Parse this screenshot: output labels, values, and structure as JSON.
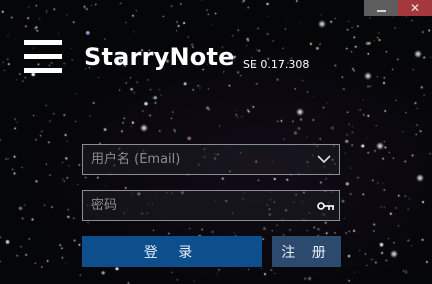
{
  "window": {
    "minimize_icon": "minimize-icon",
    "close_icon": "close-icon"
  },
  "header": {
    "menu_icon": "hamburger-menu-icon",
    "app_name": "StarryNote",
    "version": "SE 0.17.308"
  },
  "login": {
    "username": {
      "value": "",
      "placeholder": "用户名 (Email)",
      "dropdown_icon": "chevron-down-icon"
    },
    "password": {
      "value": "",
      "placeholder": "密码",
      "icon": "key-icon"
    },
    "login_label": "登 录",
    "register_label": "注 册"
  },
  "colors": {
    "background": "#050608",
    "login_button": "#0d4f8c",
    "register_button": "#2b4a6e",
    "close_button": "#a5383c",
    "minimize_button": "#5d5d5d"
  }
}
